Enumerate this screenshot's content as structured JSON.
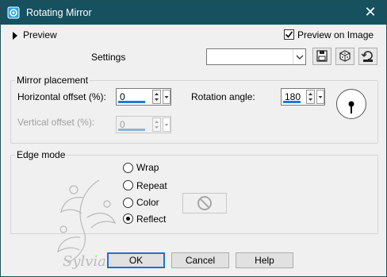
{
  "window": {
    "title": "Rotating Mirror",
    "close_glyph": "✕",
    "title_bar_color": "#17505f"
  },
  "preview": {
    "toggle_label": "Preview",
    "preview_on_image_label": "Preview on Image",
    "preview_on_image_checked": true
  },
  "settings": {
    "label": "Settings",
    "selected_value": ""
  },
  "mirror_placement": {
    "group_label": "Mirror placement",
    "horizontal_offset_label": "Horizontal offset (%):",
    "horizontal_offset_value": "0",
    "vertical_offset_label": "Vertical offset (%):",
    "vertical_offset_value": "0",
    "rotation_angle_label": "Rotation angle:",
    "rotation_angle_value": "180"
  },
  "edge_mode": {
    "group_label": "Edge mode",
    "options": [
      {
        "label": "Wrap",
        "selected": false
      },
      {
        "label": "Repeat",
        "selected": false
      },
      {
        "label": "Color",
        "selected": false
      },
      {
        "label": "Reflect",
        "selected": true
      }
    ]
  },
  "buttons": {
    "ok": "OK",
    "cancel": "Cancel",
    "help": "Help"
  },
  "watermark": {
    "text": "Sylviane"
  },
  "colors": {
    "accent": "#1e7bd6",
    "dialog_bg": "#f0f0f0"
  }
}
